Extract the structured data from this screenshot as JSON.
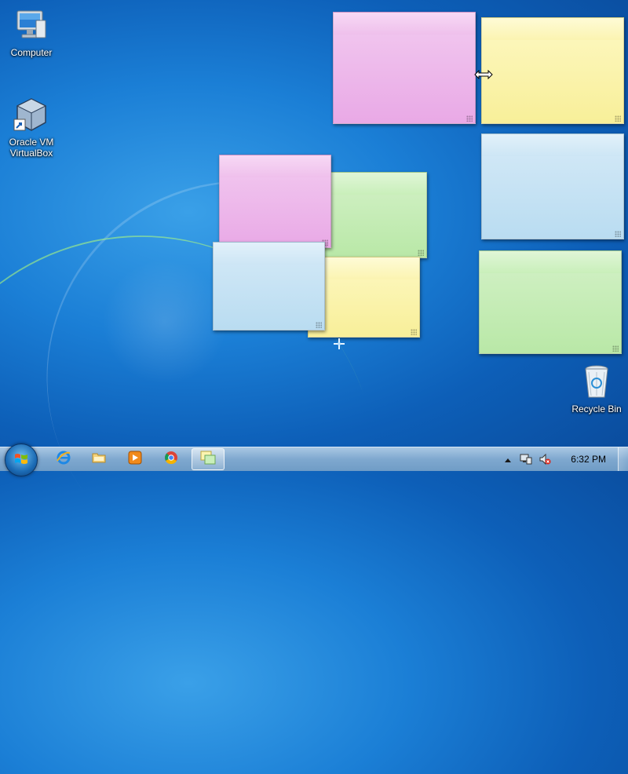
{
  "desktop": {
    "icons": [
      {
        "label": "Computer",
        "icon": "computer-icon"
      },
      {
        "label": "Oracle VM\nVirtualBox",
        "icon": "virtualbox-icon"
      },
      {
        "label": "Recycle Bin",
        "icon": "recycle-bin-icon"
      }
    ]
  },
  "sticky_notes": [
    {
      "color": "pink",
      "text": ""
    },
    {
      "color": "yellow",
      "text": ""
    },
    {
      "color": "blue",
      "text": ""
    },
    {
      "color": "green",
      "text": ""
    },
    {
      "color": "green",
      "text": ""
    },
    {
      "color": "pink",
      "text": ""
    },
    {
      "color": "yellow",
      "text": ""
    },
    {
      "color": "blue",
      "text": ""
    }
  ],
  "taskbar": {
    "start": {
      "icon": "windows-logo-icon"
    },
    "pinned": [
      {
        "app": "Internet Explorer",
        "icon": "internet-explorer-icon"
      },
      {
        "app": "Windows Explorer",
        "icon": "folder-icon"
      },
      {
        "app": "Windows Media Player",
        "icon": "media-player-icon"
      },
      {
        "app": "Google Chrome",
        "icon": "chrome-icon"
      },
      {
        "app": "Sticky Notes",
        "icon": "sticky-notes-icon",
        "active": true
      }
    ],
    "tray": {
      "icons": [
        "show-hidden-icons-arrow",
        "network-icon",
        "volume-muted-icon"
      ],
      "time": "6:32 PM"
    }
  },
  "colors": {
    "pink": "#efc0ec",
    "yellow": "#fbf4b1",
    "blue": "#cde6f5",
    "green": "#c9efba"
  }
}
